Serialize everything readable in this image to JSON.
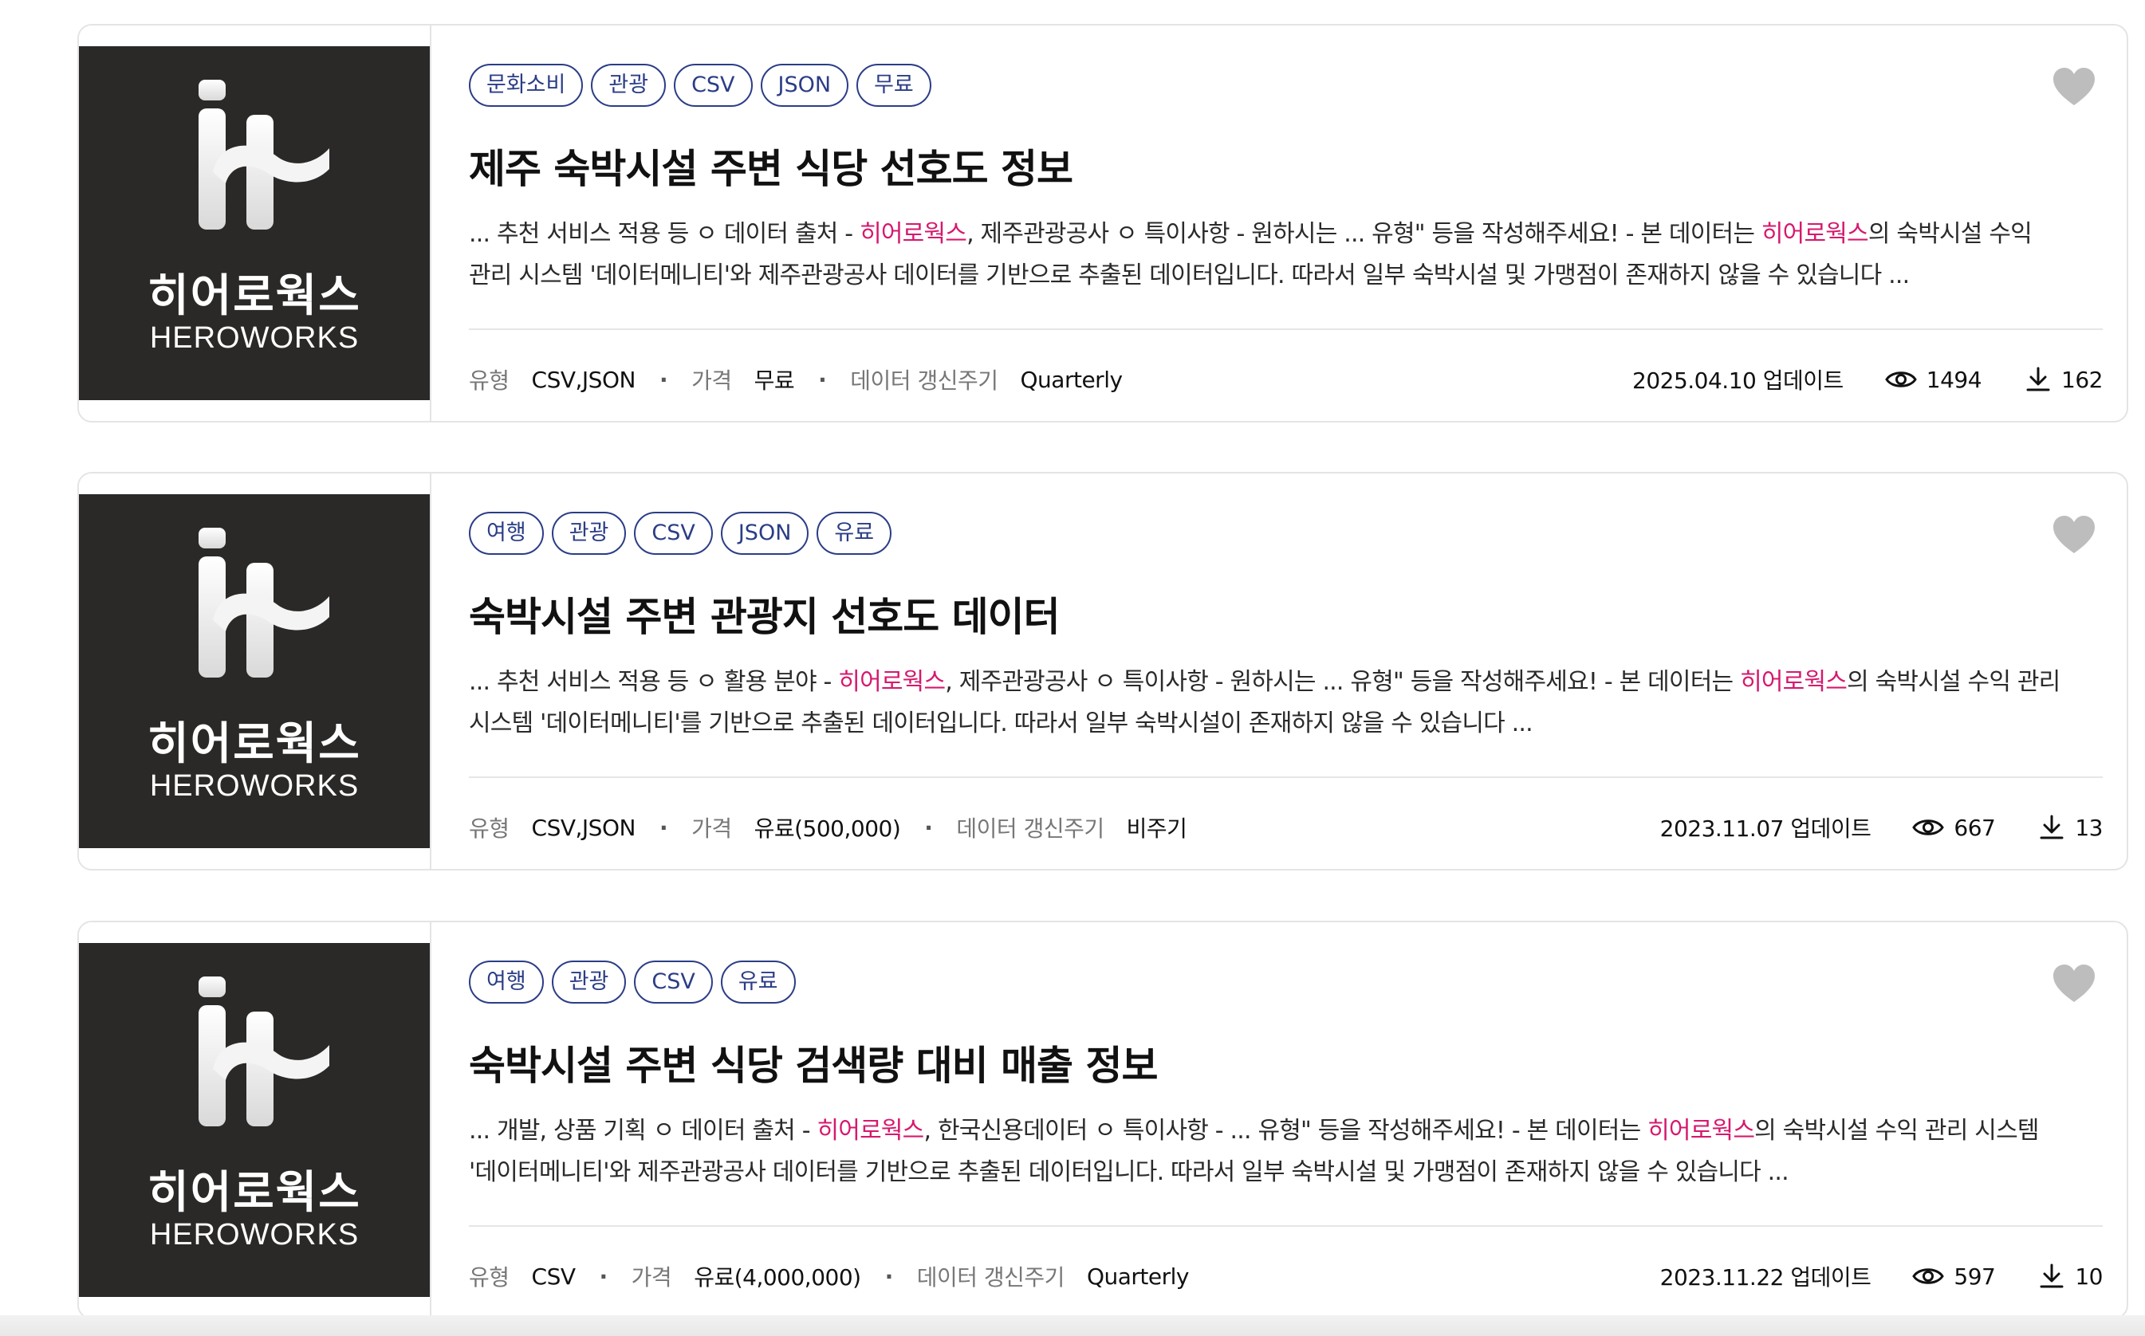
{
  "logo": {
    "name_ko": "히어로웍스",
    "name_en": "HEROWORKS"
  },
  "meta_labels": {
    "type": "유형",
    "price": "가격",
    "cycle": "데이터 갱신주기",
    "updated_suffix": "업데이트"
  },
  "icons": {
    "favorite": "heart-icon",
    "views": "eye-icon",
    "downloads": "download-icon"
  },
  "colors": {
    "tag": "#2b3d86",
    "highlight": "#d6196e",
    "thumb_bg": "#2b2927",
    "heart": "#bdbdbd"
  },
  "items": [
    {
      "tags": [
        "문화소비",
        "관광",
        "CSV",
        "JSON",
        "무료"
      ],
      "title": "제주 숙박시설 주변 식당 선호도 정보",
      "desc": [
        [
          {
            "t": "... 추천 서비스 적용 등 ㅇ 데이터 출처 - "
          },
          {
            "t": "히어로웍스",
            "hl": true
          },
          {
            "t": ", 제주관광공사 ㅇ 특이사항 - 원하시는 ... 유형\" 등을 작성해주세요! - 본 데이터는 "
          },
          {
            "t": "히어로웍스",
            "hl": true
          },
          {
            "t": "의 숙박시설 수익"
          }
        ],
        [
          {
            "t": "관리 시스템 '데이터메니티'와 제주관광공사 데이터를 기반으로 추출된 데이터입니다. 따라서 일부 숙박시설 및 가맹점이 존재하지 않을 수 있습니다 ..."
          }
        ]
      ],
      "type": "CSV,JSON",
      "price": "무료",
      "cycle": "Quarterly",
      "updated": "2025.04.10",
      "views": "1494",
      "downloads": "162"
    },
    {
      "tags": [
        "여행",
        "관광",
        "CSV",
        "JSON",
        "유료"
      ],
      "title": "숙박시설 주변 관광지 선호도 데이터",
      "desc": [
        [
          {
            "t": "... 추천 서비스 적용 등 ㅇ 활용 분야 - "
          },
          {
            "t": "히어로웍스",
            "hl": true
          },
          {
            "t": ", 제주관광공사 ㅇ 특이사항 - 원하시는 ... 유형\" 등을 작성해주세요! - 본 데이터는 "
          },
          {
            "t": "히어로웍스",
            "hl": true
          },
          {
            "t": "의 숙박시설 수익 관리"
          }
        ],
        [
          {
            "t": "시스템 '데이터메니티'를 기반으로 추출된 데이터입니다. 따라서 일부 숙박시설이 존재하지 않을 수 있습니다 ..."
          }
        ]
      ],
      "type": "CSV,JSON",
      "price": "유료(500,000)",
      "cycle": "비주기",
      "updated": "2023.11.07",
      "views": "667",
      "downloads": "13"
    },
    {
      "tags": [
        "여행",
        "관광",
        "CSV",
        "유료"
      ],
      "title": "숙박시설 주변 식당 검색량 대비 매출 정보",
      "desc": [
        [
          {
            "t": "... 개발, 상품 기획 ㅇ 데이터 출처 - "
          },
          {
            "t": "히어로웍스",
            "hl": true
          },
          {
            "t": ", 한국신용데이터 ㅇ 특이사항 - ... 유형\" 등을 작성해주세요! - 본 데이터는 "
          },
          {
            "t": "히어로웍스",
            "hl": true
          },
          {
            "t": "의 숙박시설 수익 관리 시스템"
          }
        ],
        [
          {
            "t": "'데이터메니티'와 제주관광공사 데이터를 기반으로 추출된 데이터입니다. 따라서 일부 숙박시설 및 가맹점이 존재하지 않을 수 있습니다 ..."
          }
        ]
      ],
      "type": "CSV",
      "price": "유료(4,000,000)",
      "cycle": "Quarterly",
      "updated": "2023.11.22",
      "views": "597",
      "downloads": "10"
    }
  ]
}
